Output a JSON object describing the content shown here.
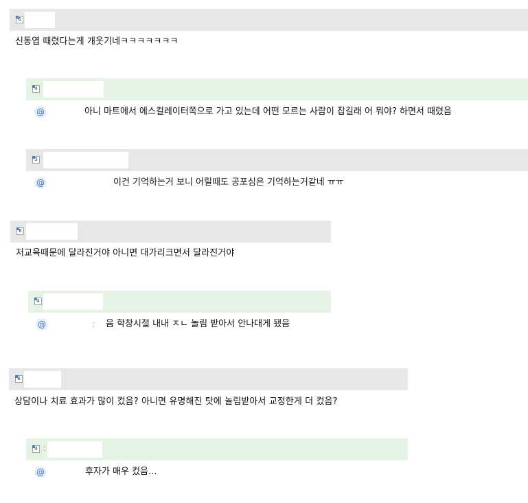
{
  "comments": [
    {
      "level": "6",
      "text": "신동엽 때렸다는게 개웃기네ㅋㅋㅋㅋㅋㅋㅋ",
      "replies": [
        {
          "level": "4",
          "text": "아니 마트에서 에스컬레이터쪽으로 가고 있는데 어떤 모르는 사람이 잡길래 어 뭐야? 하면서 때렸음"
        },
        {
          "level": "3",
          "text": "이건 기억하는거 보니 어릴때도 공포심은 기억하는거같네 ㅠㅠ"
        }
      ]
    },
    {
      "level": "6",
      "text": "저교육때문에 달라진거야 아니면 대가리크면서 달라진거야",
      "replies": [
        {
          "level": "4",
          "text": "음 학창시절 내내 ㅈㄴ 놀림 받아서 안나대게 됐음"
        }
      ]
    },
    {
      "level": "6",
      "text": "상담이나 치료 효과가 많이 컸음? 아니면 유명해진 탓에 놀림받아서 교정한게 더 컸음?",
      "replies": [
        {
          "level": "4",
          "text": "후자가 매우 컸음..."
        }
      ]
    }
  ],
  "icons": {
    "mention": "@",
    "mention_icon_name": "at-sign-icon",
    "level_icon_name": "level-badge-icon"
  }
}
